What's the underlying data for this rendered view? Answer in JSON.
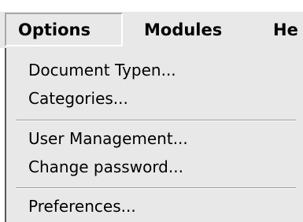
{
  "menubar": {
    "items": [
      {
        "label": "Options",
        "active": true
      },
      {
        "label": "Modules",
        "active": false
      },
      {
        "label": "He",
        "active": false
      }
    ]
  },
  "dropdown": {
    "groups": [
      [
        "Document Typen...",
        "Categories..."
      ],
      [
        "User Management...",
        "Change password..."
      ],
      [
        "Preferences..."
      ]
    ]
  }
}
